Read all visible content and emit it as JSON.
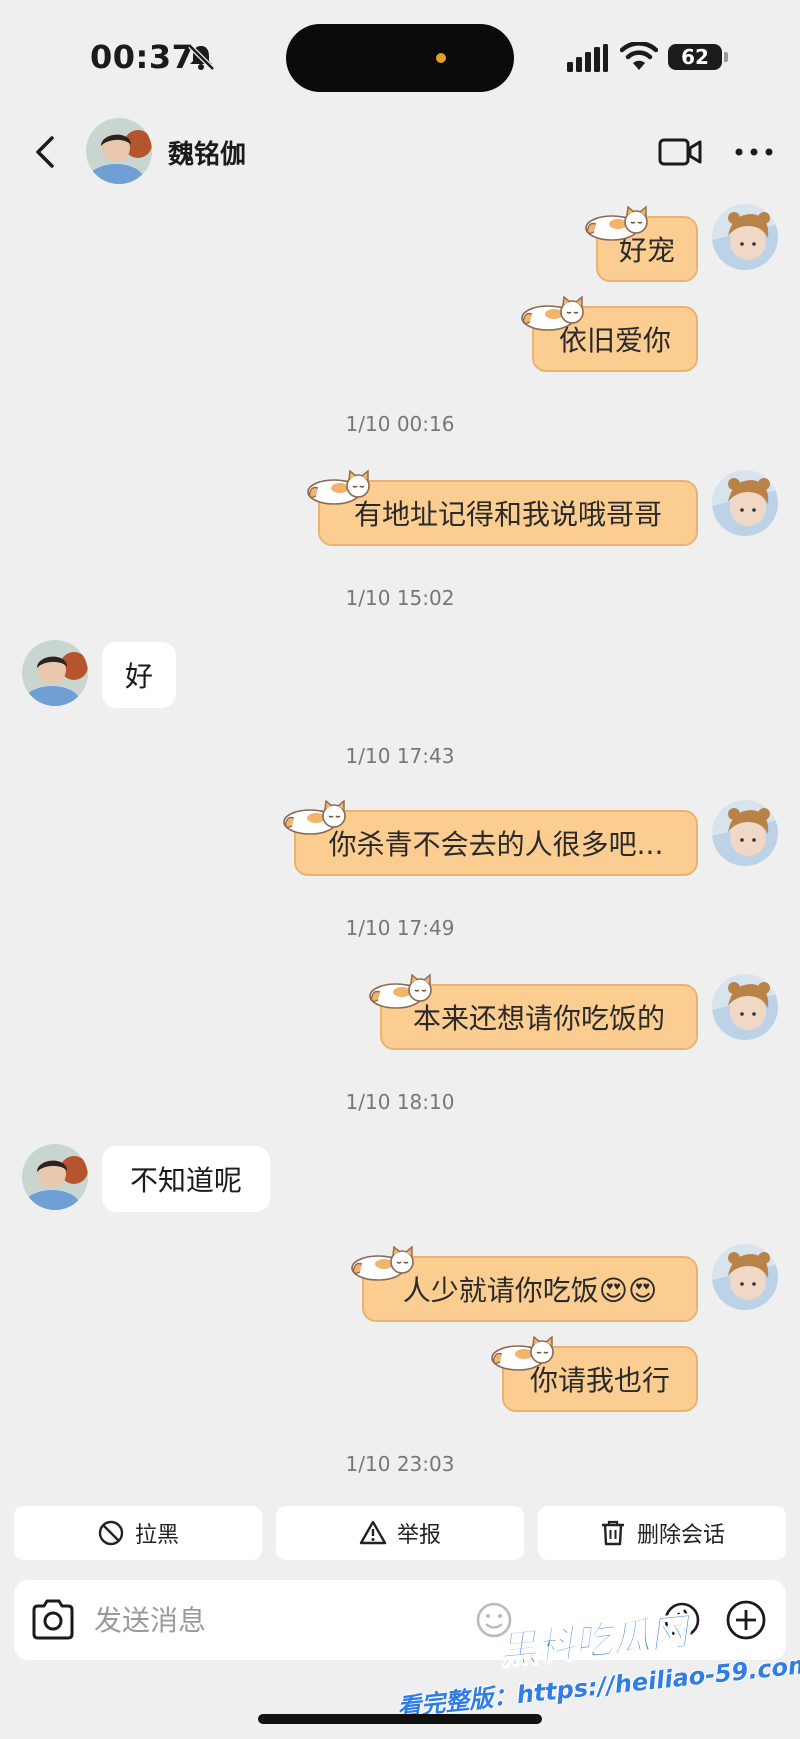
{
  "status_bar": {
    "time": "00:37",
    "battery": "62"
  },
  "header": {
    "contact_name": "魏铭伽"
  },
  "messages": [
    {
      "type": "mine",
      "text": "好宠"
    },
    {
      "type": "mine",
      "text": "依旧爱你"
    },
    {
      "type": "timestamp",
      "text": "1/10 00:16"
    },
    {
      "type": "mine",
      "text": "有地址记得和我说哦哥哥"
    },
    {
      "type": "timestamp",
      "text": "1/10 15:02"
    },
    {
      "type": "theirs",
      "text": "好"
    },
    {
      "type": "timestamp",
      "text": "1/10 17:43"
    },
    {
      "type": "mine",
      "text": "你杀青不会去的人很多吧..."
    },
    {
      "type": "timestamp",
      "text": "1/10 17:49"
    },
    {
      "type": "mine",
      "text": "本来还想请你吃饭的"
    },
    {
      "type": "timestamp",
      "text": "1/10 18:10"
    },
    {
      "type": "theirs",
      "text": "不知道呢"
    },
    {
      "type": "mine",
      "text": "人少就请你吃饭😍😍"
    },
    {
      "type": "mine",
      "text": "你请我也行"
    },
    {
      "type": "timestamp",
      "text": "1/10 23:03"
    }
  ],
  "actions": {
    "block": "拉黑",
    "report": "举报",
    "delete": "删除会话"
  },
  "input": {
    "placeholder": "发送消息"
  },
  "watermark": {
    "title": "黑料吃瓜网",
    "url": "看完整版：https://heiliao-59.com"
  },
  "colors": {
    "bubble_mine": "#fbcd91",
    "bubble_border": "#e9b273",
    "background": "#efefef",
    "watermark": "#2f7de5"
  }
}
